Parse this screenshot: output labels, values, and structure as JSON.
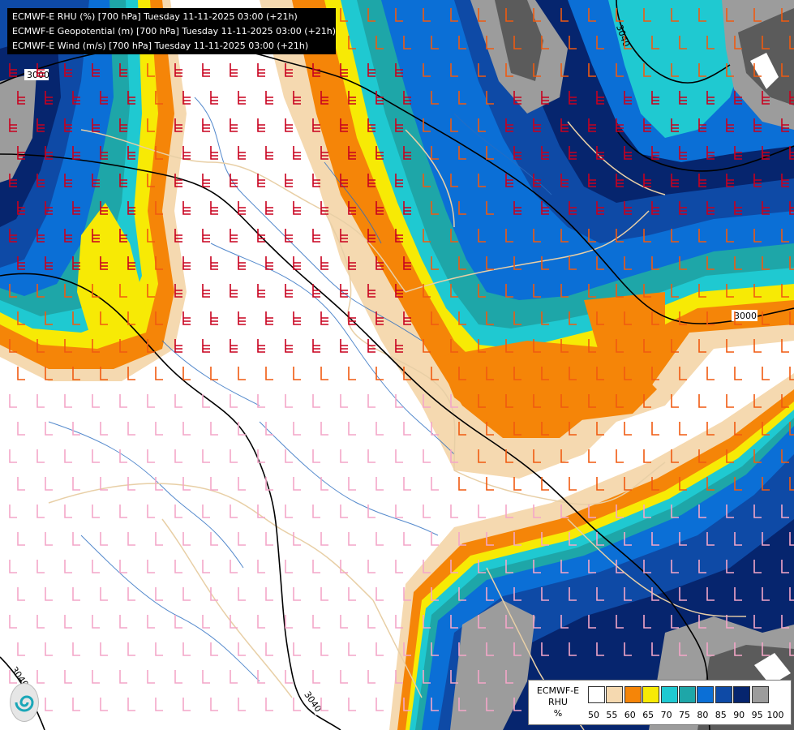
{
  "title_lines": [
    "ECMWF-E RHU (%) [700 hPa] Tuesday 11-11-2025 03:00 (+21h)",
    "ECMWF-E Geopotential (m) [700 hPa] Tuesday 11-11-2025 03:00 (+21h)",
    "ECMWF-E Wind (m/s) [700 hPa] Tuesday 11-11-2025 03:00 (+21h)"
  ],
  "legend": {
    "label_line1": "ECMWF-E",
    "label_line2": "RHU",
    "label_line3": "%",
    "ticks": [
      "50",
      "55",
      "60",
      "65",
      "70",
      "75",
      "80",
      "85",
      "90",
      "95",
      "100"
    ],
    "colors": [
      "#ffffff",
      "#f5d9b0",
      "#f58508",
      "#f7ea05",
      "#1fc9d1",
      "#1ea6a8",
      "#0b6fd6",
      "#0e4aa6",
      "#06256e",
      "#9c9c9c",
      "#5b5b5b"
    ]
  },
  "contour_labels": [
    "3000",
    "3000",
    "3040",
    "3040",
    "3040"
  ],
  "colors": {
    "rhu_50": "#ffffff",
    "rhu_55": "#f5d9b0",
    "rhu_60": "#f58508",
    "rhu_65": "#f7ea05",
    "rhu_70": "#1fc9d1",
    "rhu_75": "#1ea6a8",
    "rhu_80": "#0b6fd6",
    "rhu_85": "#0e4aa6",
    "rhu_90": "#06256e",
    "rhu_95": "#9c9c9c",
    "rhu_100": "#5b5b5b",
    "wind_strong": "#c8001e",
    "wind_medium": "#f05a10",
    "wind_light": "#f4a6c8",
    "border": "#e8cfa6",
    "rivers": "#2b6dc0",
    "contour": "#000000"
  },
  "icons": {
    "logo": "swirl-logo-icon"
  }
}
